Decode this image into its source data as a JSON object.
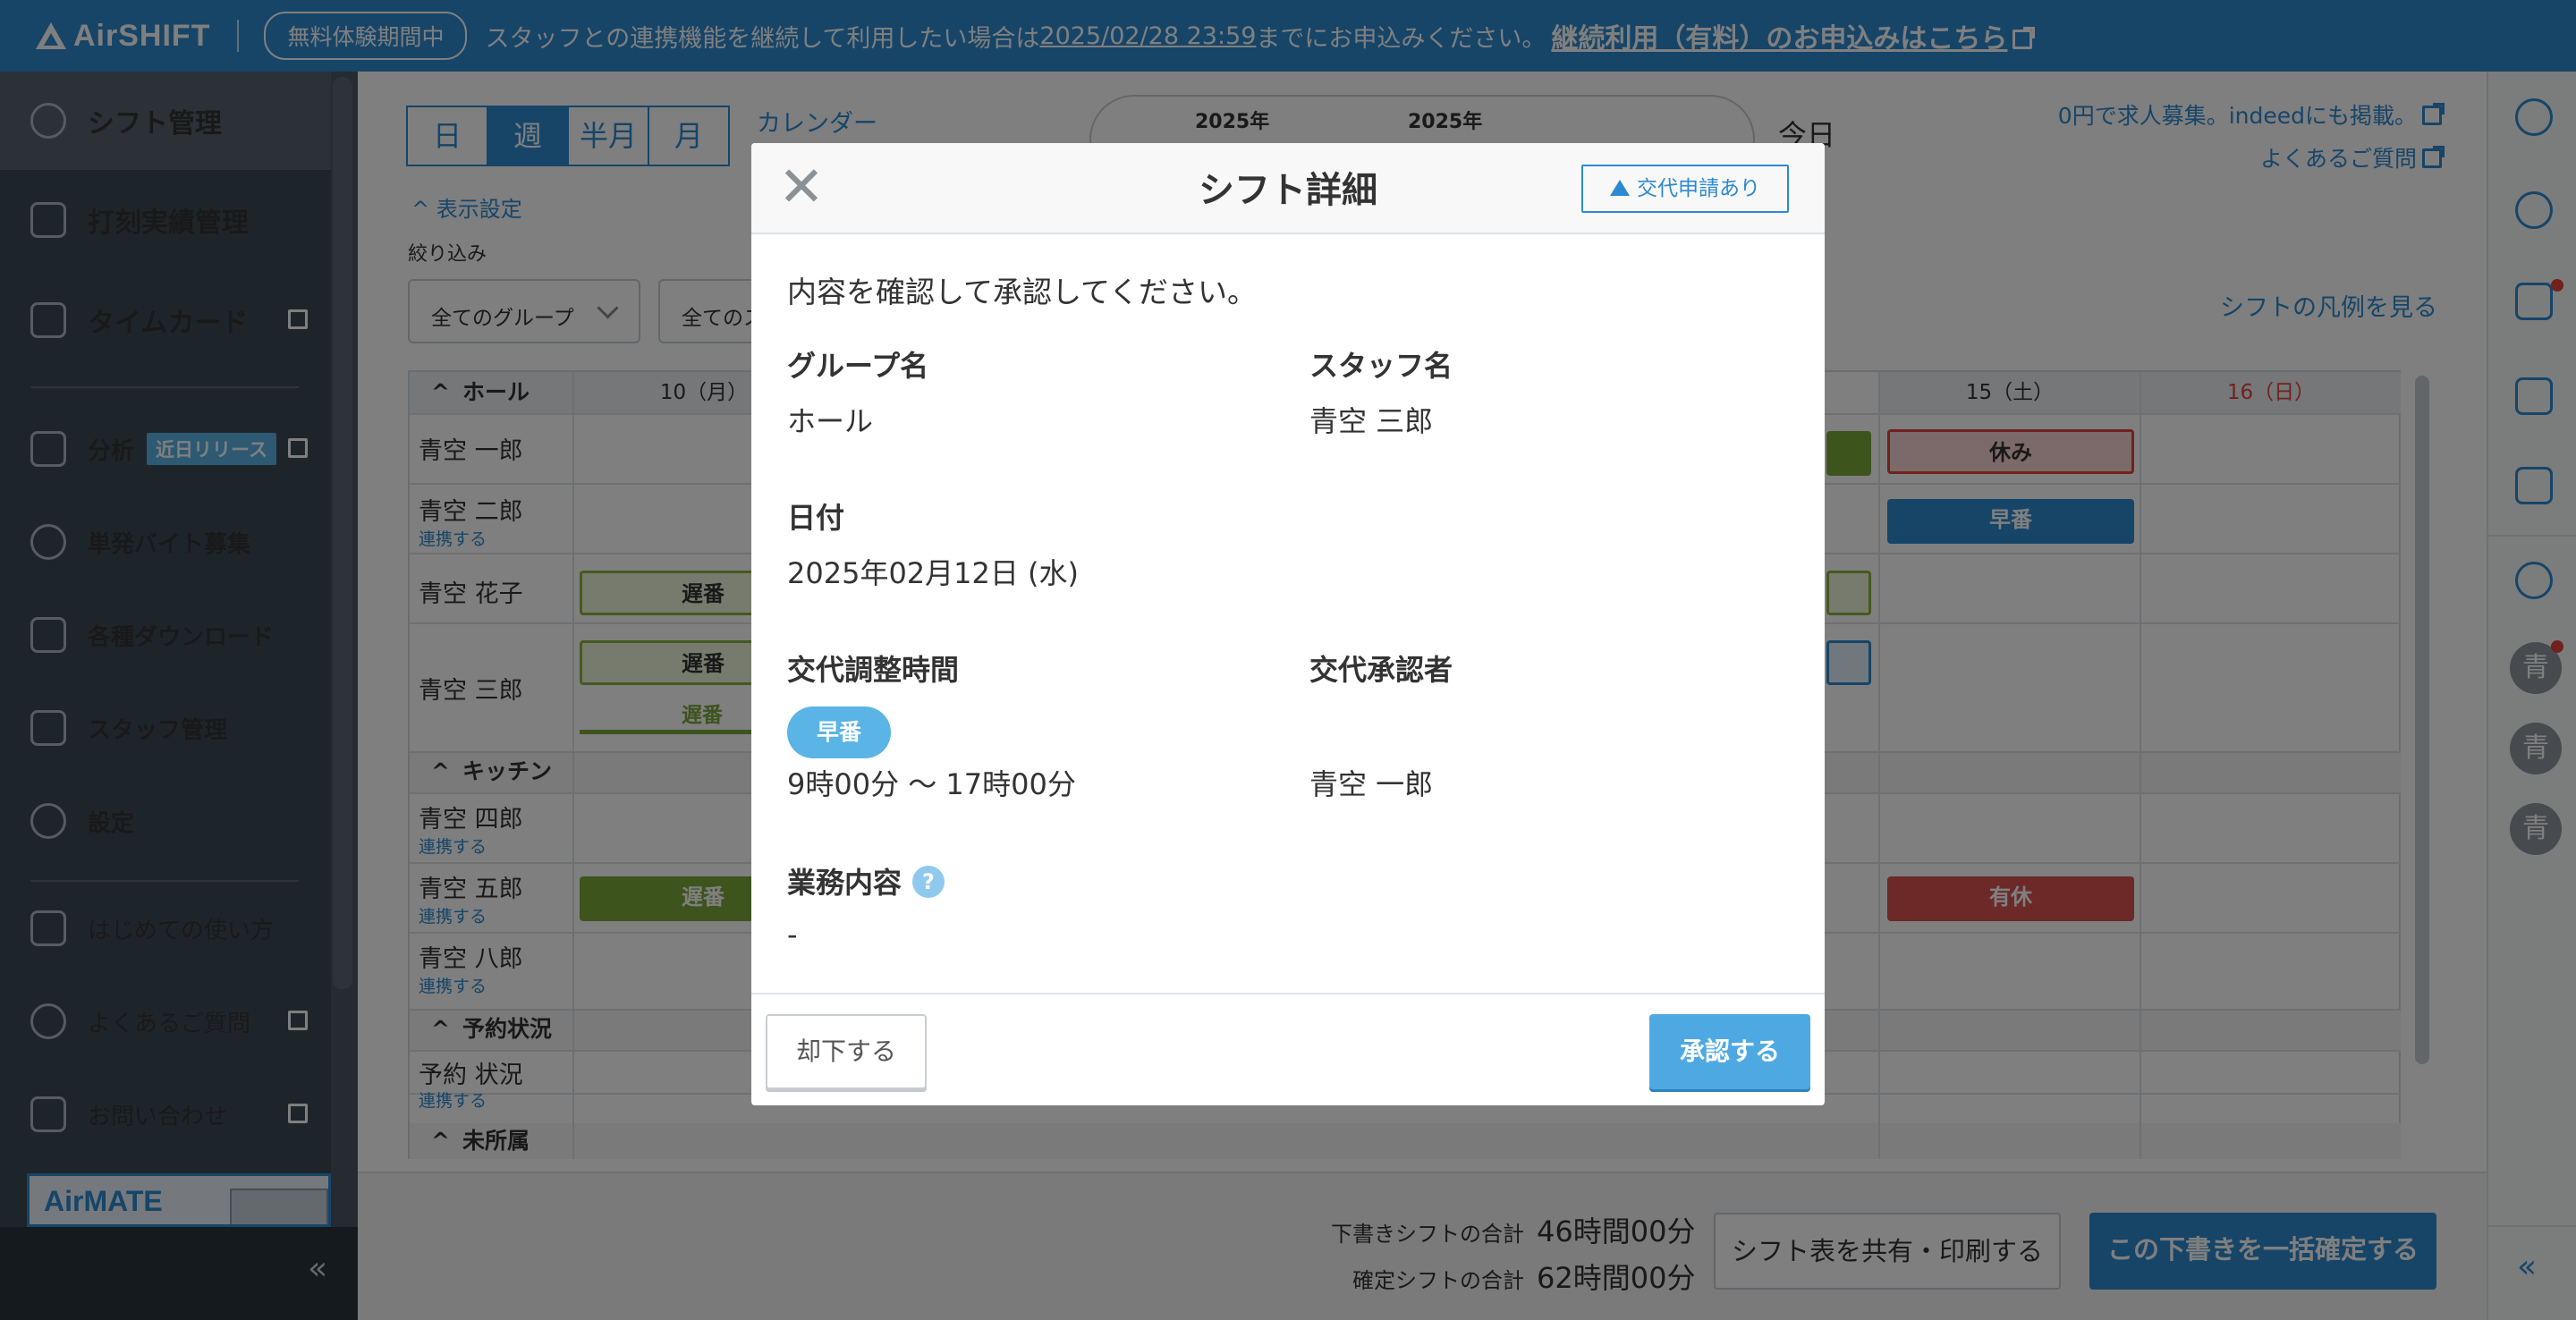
{
  "banner": {
    "logo": "AirSHIFT",
    "trial": "無料体験期間中",
    "notice_pre": "スタッフとの連携機能を継続して利用したい場合は",
    "notice_date": "2025/02/28 23:59",
    "notice_post": "までにお申込みください。",
    "notice_link": "継続利用（有料）のお申込みはこちら"
  },
  "sidebar": {
    "items": [
      {
        "label": "シフト管理"
      },
      {
        "label": "打刻実績管理"
      },
      {
        "label": "タイムカード"
      },
      {
        "label": "分析",
        "badge": "近日リリース"
      },
      {
        "label": "単発バイト募集"
      },
      {
        "label": "各種ダウンロード"
      },
      {
        "label": "スタッフ管理"
      },
      {
        "label": "設定"
      },
      {
        "label": "はじめての使い方"
      },
      {
        "label": "よくあるご質問"
      },
      {
        "label": "お問い合わせ"
      }
    ],
    "airmate": "AirMATE",
    "collapse": "«"
  },
  "toolbar": {
    "views": [
      "日",
      "週",
      "半月",
      "月"
    ],
    "calendar": "カレンダー",
    "year_start": "2025年",
    "year_end": "2025年",
    "today": "今日",
    "recruit_link": "0円で求人募集。indeedにも掲載。",
    "faq_link": "よくあるご質問",
    "display_settings": "表示設定",
    "filter_label": "絞り込み",
    "group_select": "全てのグループ",
    "staff_select": "全てのス",
    "legend_link": "シフトの凡例を見る"
  },
  "grid": {
    "groups": [
      "ホール",
      "キッチン",
      "予約状況",
      "未所属"
    ],
    "days": [
      "10（月）",
      "15（土）",
      "16（日）"
    ],
    "staff": [
      {
        "name": "青空 一郎",
        "sub": ""
      },
      {
        "name": "青空 二郎",
        "sub": "連携する"
      },
      {
        "name": "青空 花子",
        "sub": ""
      },
      {
        "name": "青空 三郎",
        "sub": ""
      },
      {
        "name": "青空 四郎",
        "sub": "連携する"
      },
      {
        "name": "青空 五郎",
        "sub": "連携する"
      },
      {
        "name": "青空 八郎",
        "sub": "連携する"
      },
      {
        "name": "予約 状況",
        "sub": "連携する"
      }
    ],
    "chips": {
      "late": "遅番",
      "early": "早番",
      "off": "休み",
      "paid": "有休"
    }
  },
  "footer": {
    "draft_label": "下書きシフトの合計",
    "draft_value": "46時間00分",
    "confirmed_label": "確定シフトの合計",
    "confirmed_value": "62時間00分",
    "share_button": "シフト表を共有・印刷する",
    "confirm_button": "この下書きを一括確定する"
  },
  "modal": {
    "title": "シフト詳細",
    "request_badge": "交代申請あり",
    "intro": "内容を確認して承認してください。",
    "group_label": "グループ名",
    "group_value": "ホール",
    "staff_label": "スタッフ名",
    "staff_value": "青空 三郎",
    "date_label": "日付",
    "date_value": "2025年02月12日 (水)",
    "time_label": "交代調整時間",
    "shift_type": "早番",
    "time_value": "9時00分 〜 17時00分",
    "approver_label": "交代承認者",
    "approver_value": "青空 一郎",
    "task_label": "業務内容",
    "task_value": "-",
    "reject_button": "却下する",
    "approve_button": "承認する"
  },
  "rightrail": {
    "avatar": "青"
  },
  "colors": {
    "brand": "#2d8ad0",
    "sidebar": "#3c4a55",
    "late": "#7aa83a",
    "off": "#e0443b",
    "approve": "#4ea9e3"
  }
}
